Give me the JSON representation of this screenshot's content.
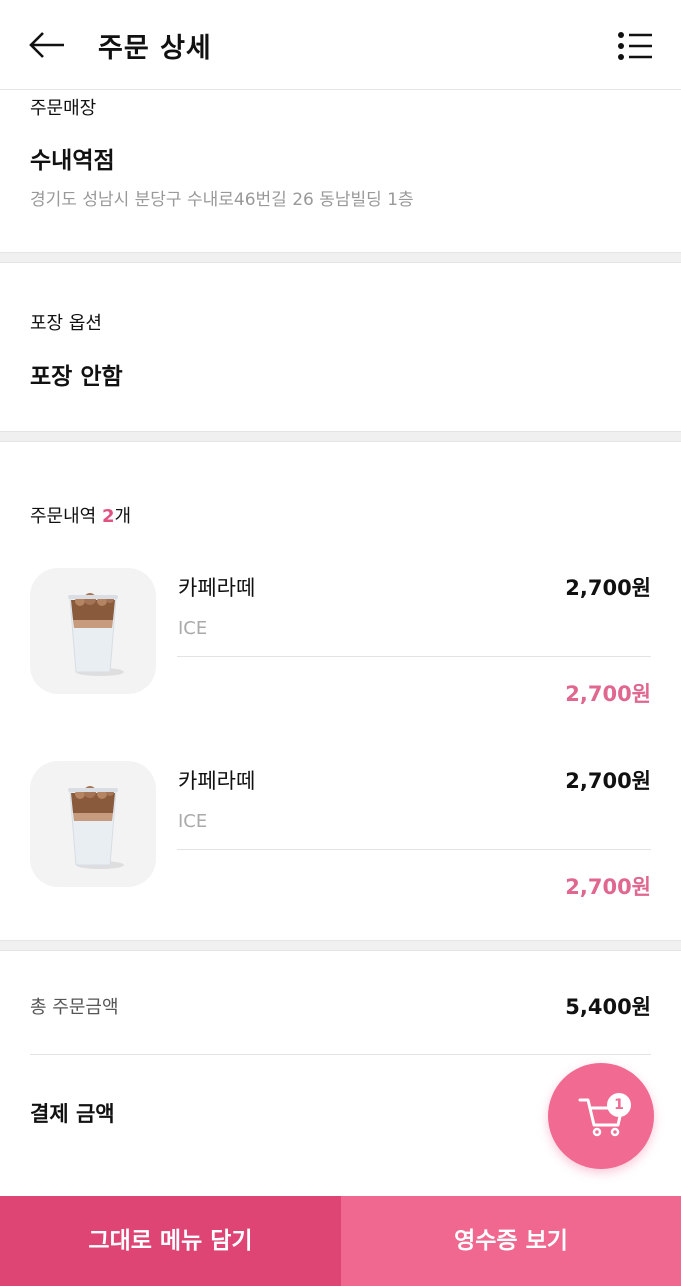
{
  "header": {
    "title": "주문 상세",
    "back_icon": "arrow-left-icon",
    "menu_icon": "list-icon"
  },
  "store": {
    "label": "주문매장",
    "name": "수내역점",
    "address": "경기도 성남시 분당구 수내로46번길 26 동남빌딩 1층"
  },
  "packaging": {
    "label": "포장 옵션",
    "value": "포장 안함"
  },
  "order": {
    "label": "주문내역",
    "count": "2",
    "count_suffix": "개",
    "items": [
      {
        "name": "카페라떼",
        "price": "2,700원",
        "option": "ICE",
        "total": "2,700원"
      },
      {
        "name": "카페라떼",
        "price": "2,700원",
        "option": "ICE",
        "total": "2,700원"
      }
    ]
  },
  "summary": {
    "total_label": "총 주문금액",
    "total_value": "5,400원",
    "pay_label": "결제 금액"
  },
  "cart": {
    "badge": "1",
    "icon": "cart-icon"
  },
  "buttons": {
    "reorder": "그대로 메뉴 담기",
    "receipt": "영수증 보기"
  },
  "colors": {
    "accent": "#e0527f",
    "price_accent": "#e0678f",
    "button_left": "#de4474",
    "button_right": "#f06890",
    "fab": "#f06a92"
  }
}
